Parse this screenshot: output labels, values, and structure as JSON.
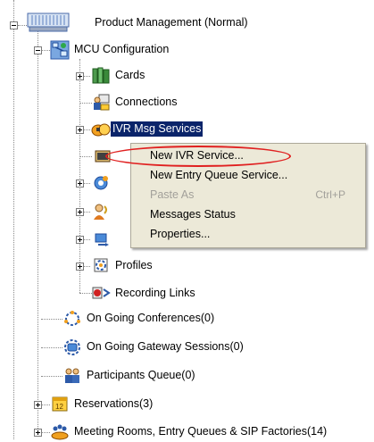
{
  "tree": {
    "root": {
      "label": "Product Management  (Normal)",
      "icon": "computer-icon",
      "expanded": true
    },
    "mcu_configuration": {
      "label": "MCU Configuration",
      "icon": "network-config-icon",
      "expanded": true
    },
    "cards": {
      "label": "Cards",
      "icon": "cards-icon"
    },
    "connections": {
      "label": "Connections",
      "icon": "connections-icon"
    },
    "ivr_msg_services": {
      "label": "IVR Msg Services",
      "icon": "ivr-icon",
      "selected": true
    },
    "profiles": {
      "label": "Profiles",
      "icon": "profiles-icon"
    },
    "recording_links": {
      "label": "Recording Links",
      "icon": "recording-links-icon"
    },
    "ongoing_conferences": {
      "label": "On Going Conferences(0)",
      "icon": "conference-icon"
    },
    "ongoing_gateway": {
      "label": "On Going Gateway Sessions(0)",
      "icon": "gateway-icon"
    },
    "participants_queue": {
      "label": "Participants Queue(0)",
      "icon": "participants-icon"
    },
    "reservations": {
      "label": "Reservations(3)",
      "icon": "calendar-icon"
    },
    "meeting_rooms": {
      "label": "Meeting Rooms, Entry Queues & SIP Factories(14)",
      "icon": "meeting-rooms-icon"
    }
  },
  "context_menu": {
    "items": [
      {
        "label": "New IVR Service...",
        "enabled": true
      },
      {
        "label": "New Entry Queue Service...",
        "enabled": true
      },
      {
        "label": "Paste As",
        "shortcut": "Ctrl+P",
        "enabled": false
      },
      {
        "label": "Messages Status",
        "enabled": true
      },
      {
        "label": "Properties...",
        "enabled": true
      }
    ]
  },
  "colors": {
    "selection": "#0a246a",
    "menu_bg": "#ece9d8",
    "highlight_oval": "#e02020"
  }
}
